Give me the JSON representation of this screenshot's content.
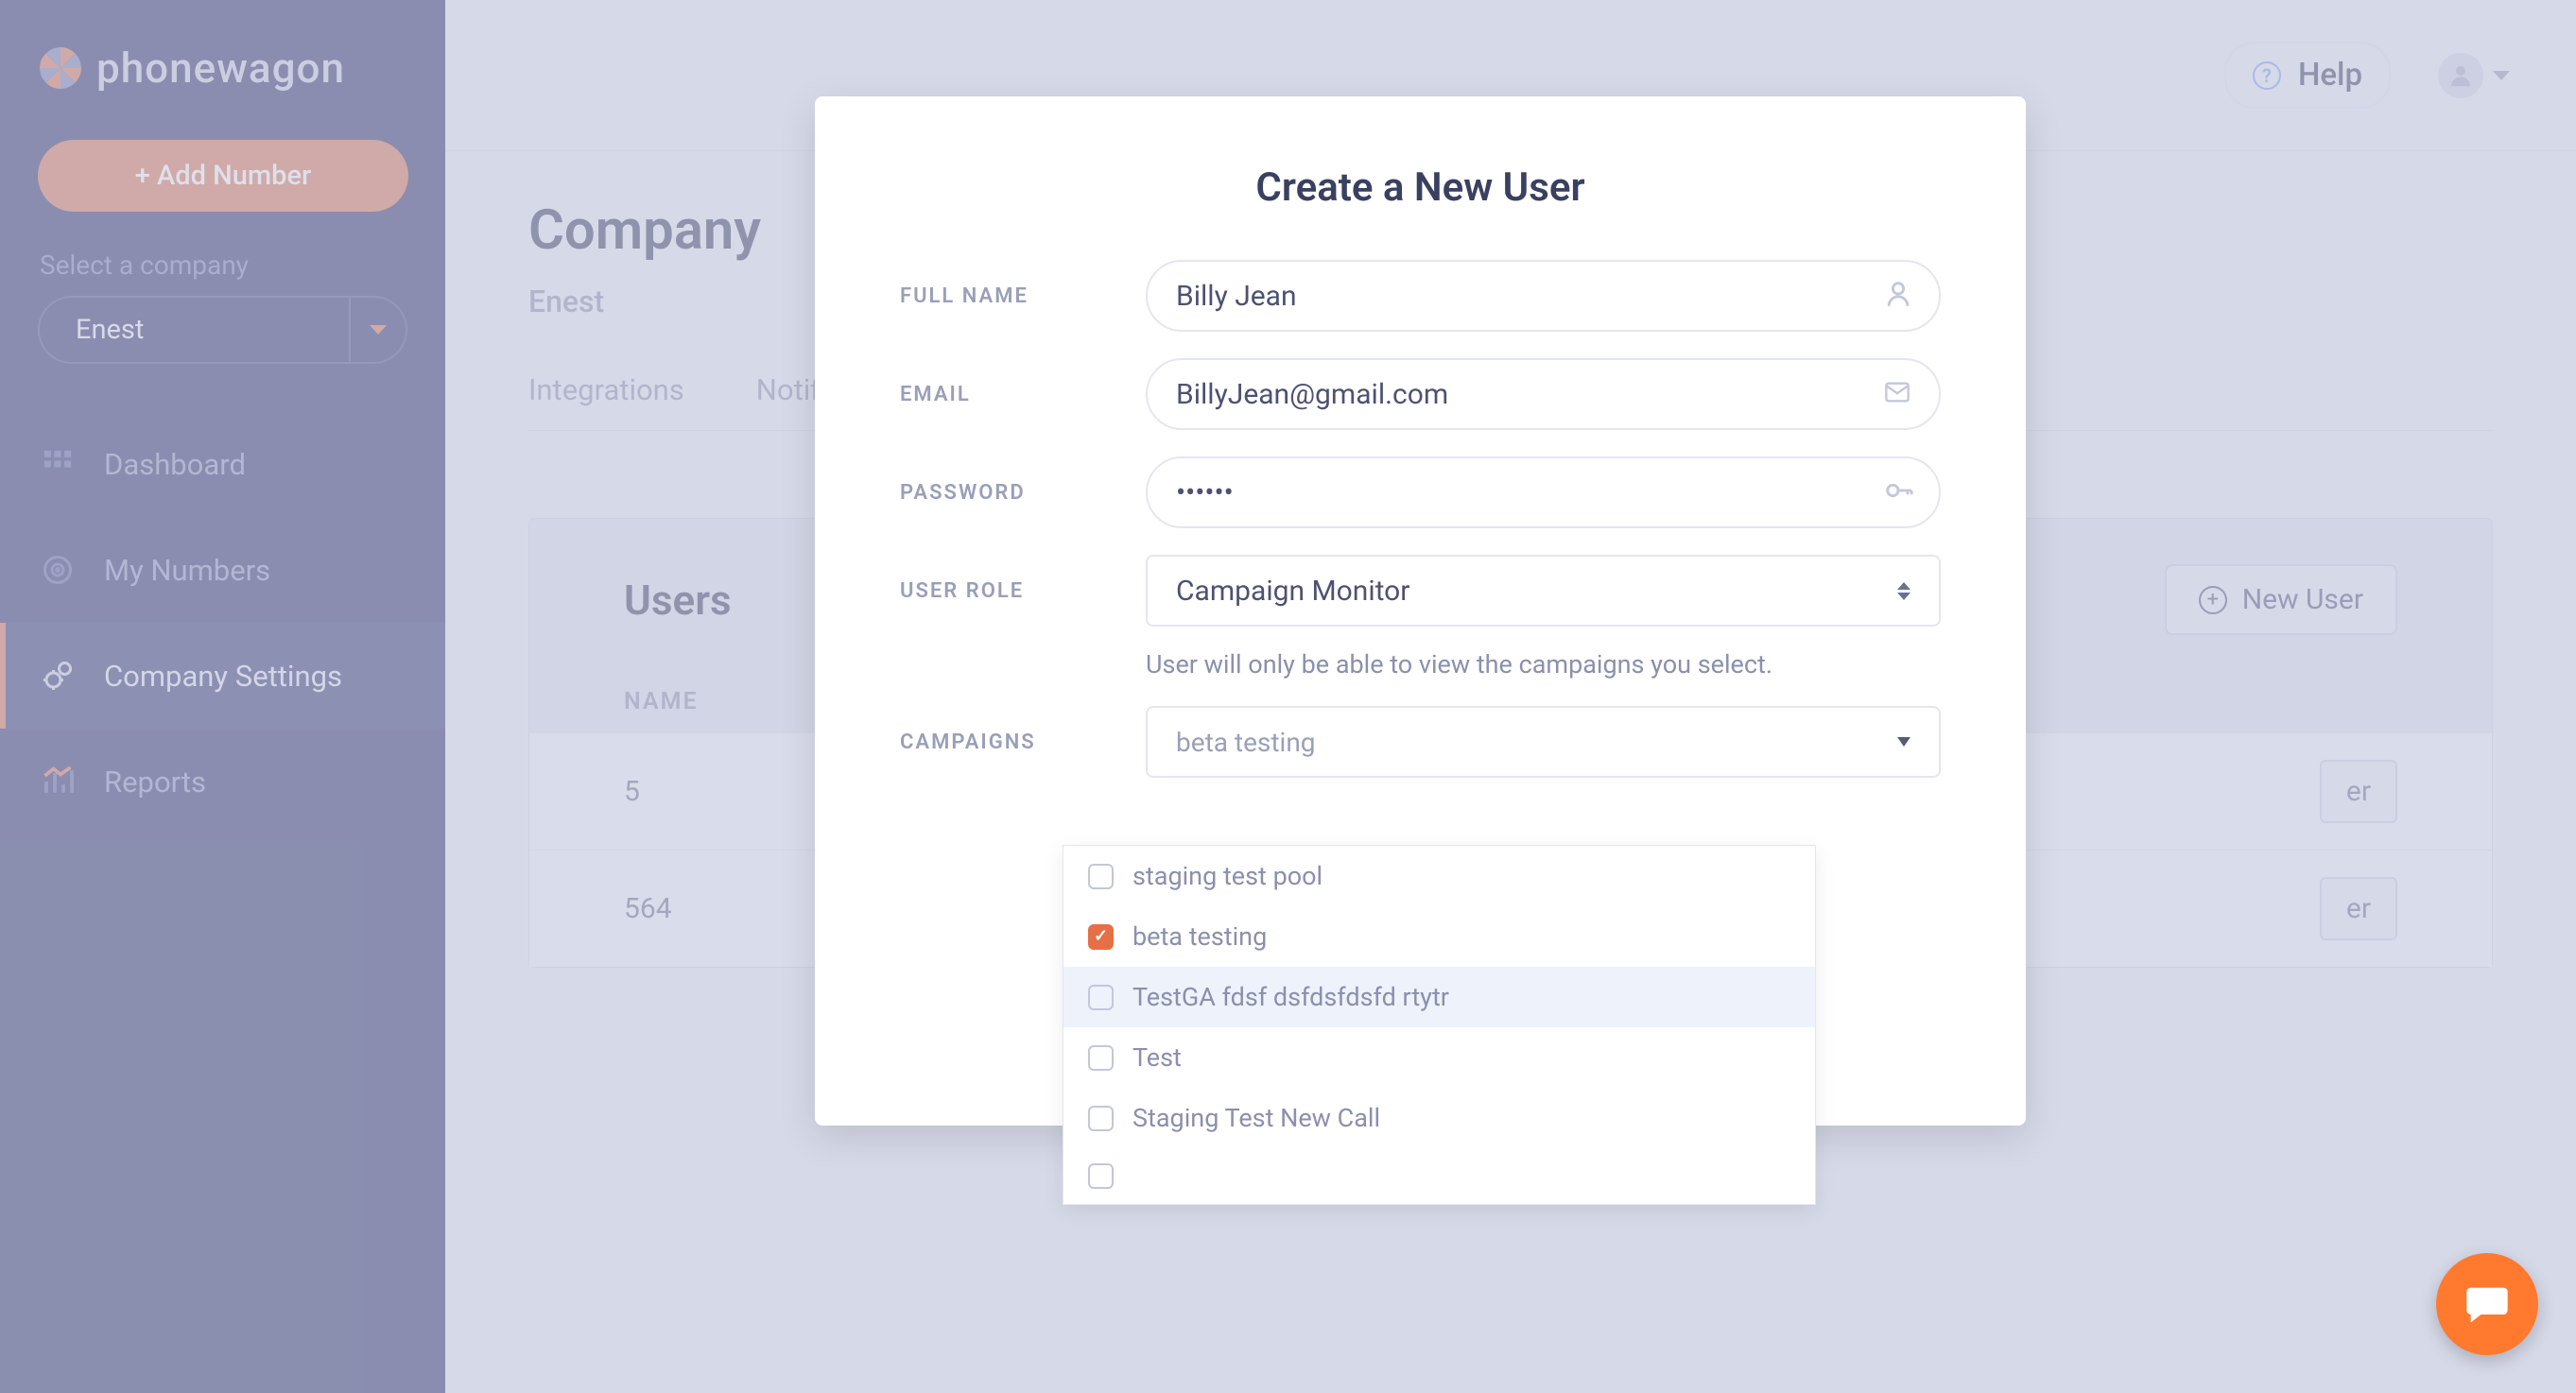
{
  "brand": {
    "name": "phonewagon"
  },
  "sidebar": {
    "add_number": "+ Add Number",
    "select_company_label": "Select a company",
    "company_selected": "Enest",
    "nav": [
      {
        "label": "Dashboard"
      },
      {
        "label": "My Numbers"
      },
      {
        "label": "Company Settings"
      },
      {
        "label": "Reports"
      }
    ]
  },
  "topbar": {
    "help": "Help"
  },
  "page": {
    "title": "Company",
    "company": "Enest",
    "tabs": [
      {
        "label": "Integrations"
      },
      {
        "label": "Notifi"
      }
    ]
  },
  "users_panel": {
    "title": "Users",
    "new_user": "New User",
    "columns": {
      "name": "NAME"
    },
    "rows": [
      {
        "name": "5",
        "role_suffix": "er"
      },
      {
        "name": "564",
        "role_suffix": "er"
      }
    ]
  },
  "modal": {
    "title": "Create a New User",
    "labels": {
      "full_name": "FULL NAME",
      "email": "EMAIL",
      "password": "PASSWORD",
      "user_role": "USER ROLE",
      "campaigns": "CAMPAIGNS"
    },
    "values": {
      "full_name": "Billy Jean",
      "email": "BillyJean@gmail.com",
      "password": "••••••",
      "user_role": "Campaign Monitor",
      "campaign_selected": "beta testing"
    },
    "helper": "User will only be able to view the campaigns you select."
  },
  "campaign_dropdown": [
    {
      "label": "staging test pool",
      "checked": false
    },
    {
      "label": "beta testing",
      "checked": true
    },
    {
      "label": "TestGA fdsf dsfdsfdsfd rtytr",
      "checked": false,
      "hover": true
    },
    {
      "label": "Test",
      "checked": false
    },
    {
      "label": "Staging Test New Call",
      "checked": false
    },
    {
      "label": "",
      "checked": false
    }
  ]
}
